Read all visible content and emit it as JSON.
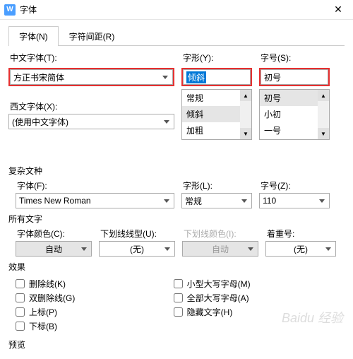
{
  "window": {
    "title": "字体"
  },
  "tabs": {
    "font": "字体(N)",
    "spacing": "字符间距(R)"
  },
  "labels": {
    "cnFont": "中文字体(T):",
    "style": "字形(Y):",
    "size": "字号(S):",
    "westFont": "西文字体(X):",
    "complex": "复杂文种",
    "cFont": "字体(F):",
    "cStyle": "字形(L):",
    "cSize": "字号(Z):",
    "allText": "所有文字",
    "fontColor": "字体颜色(C):",
    "underline": "下划线线型(U):",
    "ulColor": "下划线颜色(I):",
    "emphasis": "着重号:",
    "effects": "效果",
    "preview": "预览"
  },
  "values": {
    "cnFont": "方正书宋简体",
    "style": "倾斜",
    "size": "初号",
    "westFont": "(使用中文字体)",
    "cFont": "Times New Roman",
    "cStyle": "常规",
    "cSize": "110",
    "fontColor": "自动",
    "underline": "(无)",
    "ulColor": "自动",
    "emphasis": "(无)"
  },
  "styleList": [
    "常规",
    "倾斜",
    "加粗"
  ],
  "sizeList": [
    "初号",
    "小初",
    "一号"
  ],
  "effectsList": {
    "col1": [
      {
        "id": "strike",
        "label": "删除线(K)"
      },
      {
        "id": "dstrike",
        "label": "双删除线(G)"
      },
      {
        "id": "super",
        "label": "上标(P)"
      },
      {
        "id": "sub",
        "label": "下标(B)"
      }
    ],
    "col2": [
      {
        "id": "smallcaps",
        "label": "小型大写字母(M)"
      },
      {
        "id": "allcaps",
        "label": "全部大写字母(A)"
      },
      {
        "id": "hidden",
        "label": "隐藏文字(H)"
      }
    ]
  },
  "watermark": "Baidu 经验"
}
